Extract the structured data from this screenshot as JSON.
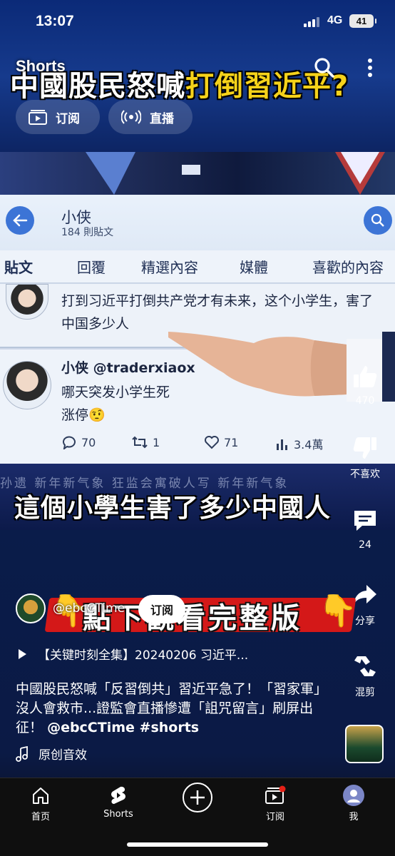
{
  "status_bar": {
    "time": "13:07",
    "network": "4G",
    "battery": "41"
  },
  "header": {
    "app_label": "Shorts",
    "headline_part1": "中國股民怒喊",
    "headline_part2": "打倒習近平?",
    "chips": [
      {
        "label": "订阅",
        "icon": "subscriptions-icon"
      },
      {
        "label": "直播",
        "icon": "live-icon"
      }
    ]
  },
  "video": {
    "twitter_profile": {
      "name": "小侠",
      "post_count": "184 則貼文"
    },
    "tabs": [
      "貼文",
      "回覆",
      "精選內容",
      "媒體",
      "喜歡的內容"
    ],
    "tweet1_text": "打到习近平打倒共产党才有未来，这个小学生，害了中国多少人",
    "tweet2_author": "小侠 @traderxiaox",
    "tweet2_text_line1": "哪天突发小学生死",
    "tweet2_text_line2": "涨停",
    "tweet2_emoji": "🤨",
    "tweet2_stats": {
      "replies": "70",
      "retweets": "1",
      "likes": "71",
      "views": "3.4萬"
    },
    "ticker_text": "孙遗   新年新气象 狂监会寓破人写   新年新气象",
    "subtitle": "這個小學生害了多少中國人"
  },
  "actions": [
    {
      "name": "like",
      "label": "470",
      "icon": "thumbs-up-icon"
    },
    {
      "name": "dislike",
      "label": "不喜欢",
      "icon": "thumbs-down-icon"
    },
    {
      "name": "comments",
      "label": "24",
      "icon": "comment-icon"
    },
    {
      "name": "share",
      "label": "分享",
      "icon": "share-icon"
    },
    {
      "name": "remix",
      "label": "混剪",
      "icon": "remix-icon"
    }
  ],
  "info": {
    "promo_text": "點下觀看完整版",
    "channel_handle": "@ebcCTime",
    "subscribe_label": "订阅",
    "playlist_title": "【关键时刻全集】20240206 习近平...",
    "description": "中國股民怒喊「反習倒共」習近平急了！「習家軍」沒人會救市...證監會直播慘遭「詛咒留言」刷屏出征！",
    "description_tags": "@ebcCTime #shorts",
    "music_label": "原创音效"
  },
  "nav": [
    {
      "label": "首页",
      "icon": "home-icon"
    },
    {
      "label": "Shorts",
      "icon": "shorts-icon"
    },
    {
      "label": "",
      "icon": "create-plus-icon"
    },
    {
      "label": "订阅",
      "icon": "subscriptions-icon"
    },
    {
      "label": "我",
      "icon": "profile-avatar-icon"
    }
  ],
  "colors": {
    "accent_yellow": "#f5d21a",
    "brand_red": "#d41818",
    "twitter_blue": "#3c74d6"
  }
}
